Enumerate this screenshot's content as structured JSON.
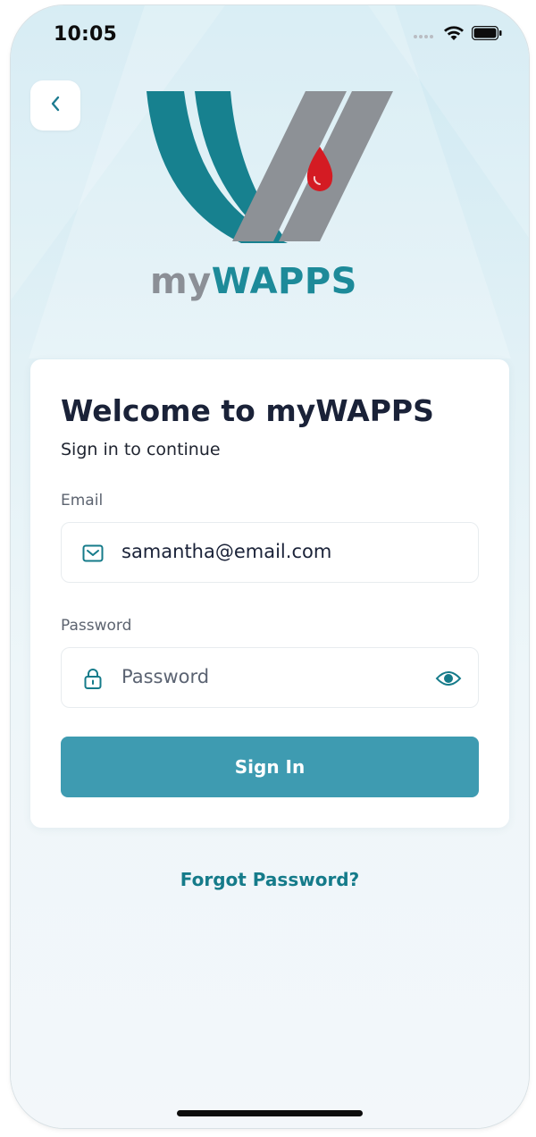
{
  "status_bar": {
    "time": "10:05",
    "icons": [
      "signal-dots-icon",
      "wifi-icon",
      "battery-icon"
    ]
  },
  "nav": {
    "back_icon": "chevron-left-icon"
  },
  "brand": {
    "logo_icon": "wapps-logo-icon",
    "prefix": "my",
    "name": "WAPPS"
  },
  "login": {
    "title": "Welcome to myWAPPS",
    "subtitle": "Sign in to continue",
    "email": {
      "label": "Email",
      "value": "samantha@email.com",
      "icon": "mail-icon"
    },
    "password": {
      "label": "Password",
      "placeholder": "Password",
      "icon": "lock-icon",
      "toggle_icon": "eye-icon"
    },
    "submit_label": "Sign In"
  },
  "forgot_password_label": "Forgot Password?",
  "colors": {
    "accent": "#3e9bb1",
    "link": "#157b8a",
    "brand_teal": "#1d8a99",
    "brand_gray": "#8b8f96",
    "logo_red": "#d41b23",
    "title": "#1a2238"
  }
}
